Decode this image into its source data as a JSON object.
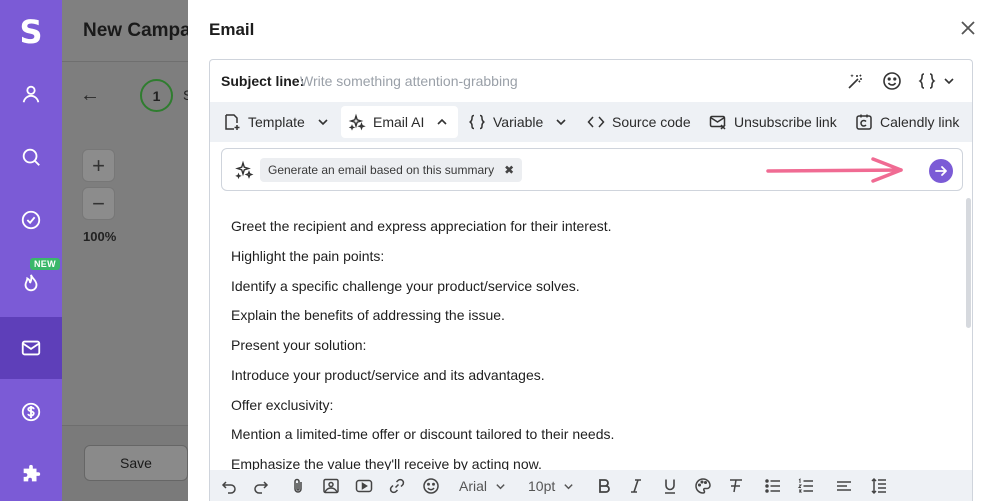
{
  "sidebar": {
    "logo": "S",
    "new_badge": "NEW",
    "items": [
      {
        "icon": "user-icon"
      },
      {
        "icon": "search-icon"
      },
      {
        "icon": "check-circle-icon"
      },
      {
        "icon": "flame-icon"
      },
      {
        "icon": "mail-icon",
        "active": true
      },
      {
        "icon": "dollar-icon"
      },
      {
        "icon": "puzzle-icon"
      }
    ]
  },
  "background_page": {
    "title": "New Campai",
    "step_number": "1",
    "step_label": "S",
    "zoom_in": "+",
    "zoom_out": "−",
    "zoom_level": "100%",
    "save_label": "Save"
  },
  "modal": {
    "title": "Email",
    "subject": {
      "label": "Subject line:",
      "placeholder": "Write something attention-grabbing"
    },
    "toolbar": {
      "template": "Template",
      "email_ai": "Email AI",
      "variable": "Variable",
      "source_code": "Source code",
      "unsubscribe": "Unsubscribe link",
      "calendly": "Calendly link"
    },
    "ai_prompt": {
      "chip": "Generate an email based on this summary",
      "chip_remove": "✖"
    },
    "body_lines": [
      "Greet the recipient and express appreciation for their interest.",
      "Highlight the pain points:",
      "Identify a specific challenge your product/service solves.",
      "Explain the benefits of addressing the issue.",
      "Present your solution:",
      "Introduce your product/service and its advantages.",
      "Offer exclusivity:",
      "Mention a limited-time offer or discount tailored to their needs.",
      "Emphasize the value they'll receive by acting now."
    ],
    "format_bar": {
      "font": "Arial",
      "size": "10pt"
    }
  },
  "colors": {
    "sidebar": "#7b5bd6",
    "sidebar_active": "#5e3fb9",
    "accent": "#7b5bd6",
    "annotation_arrow": "#f06b93",
    "new_badge": "#3ab76a"
  }
}
